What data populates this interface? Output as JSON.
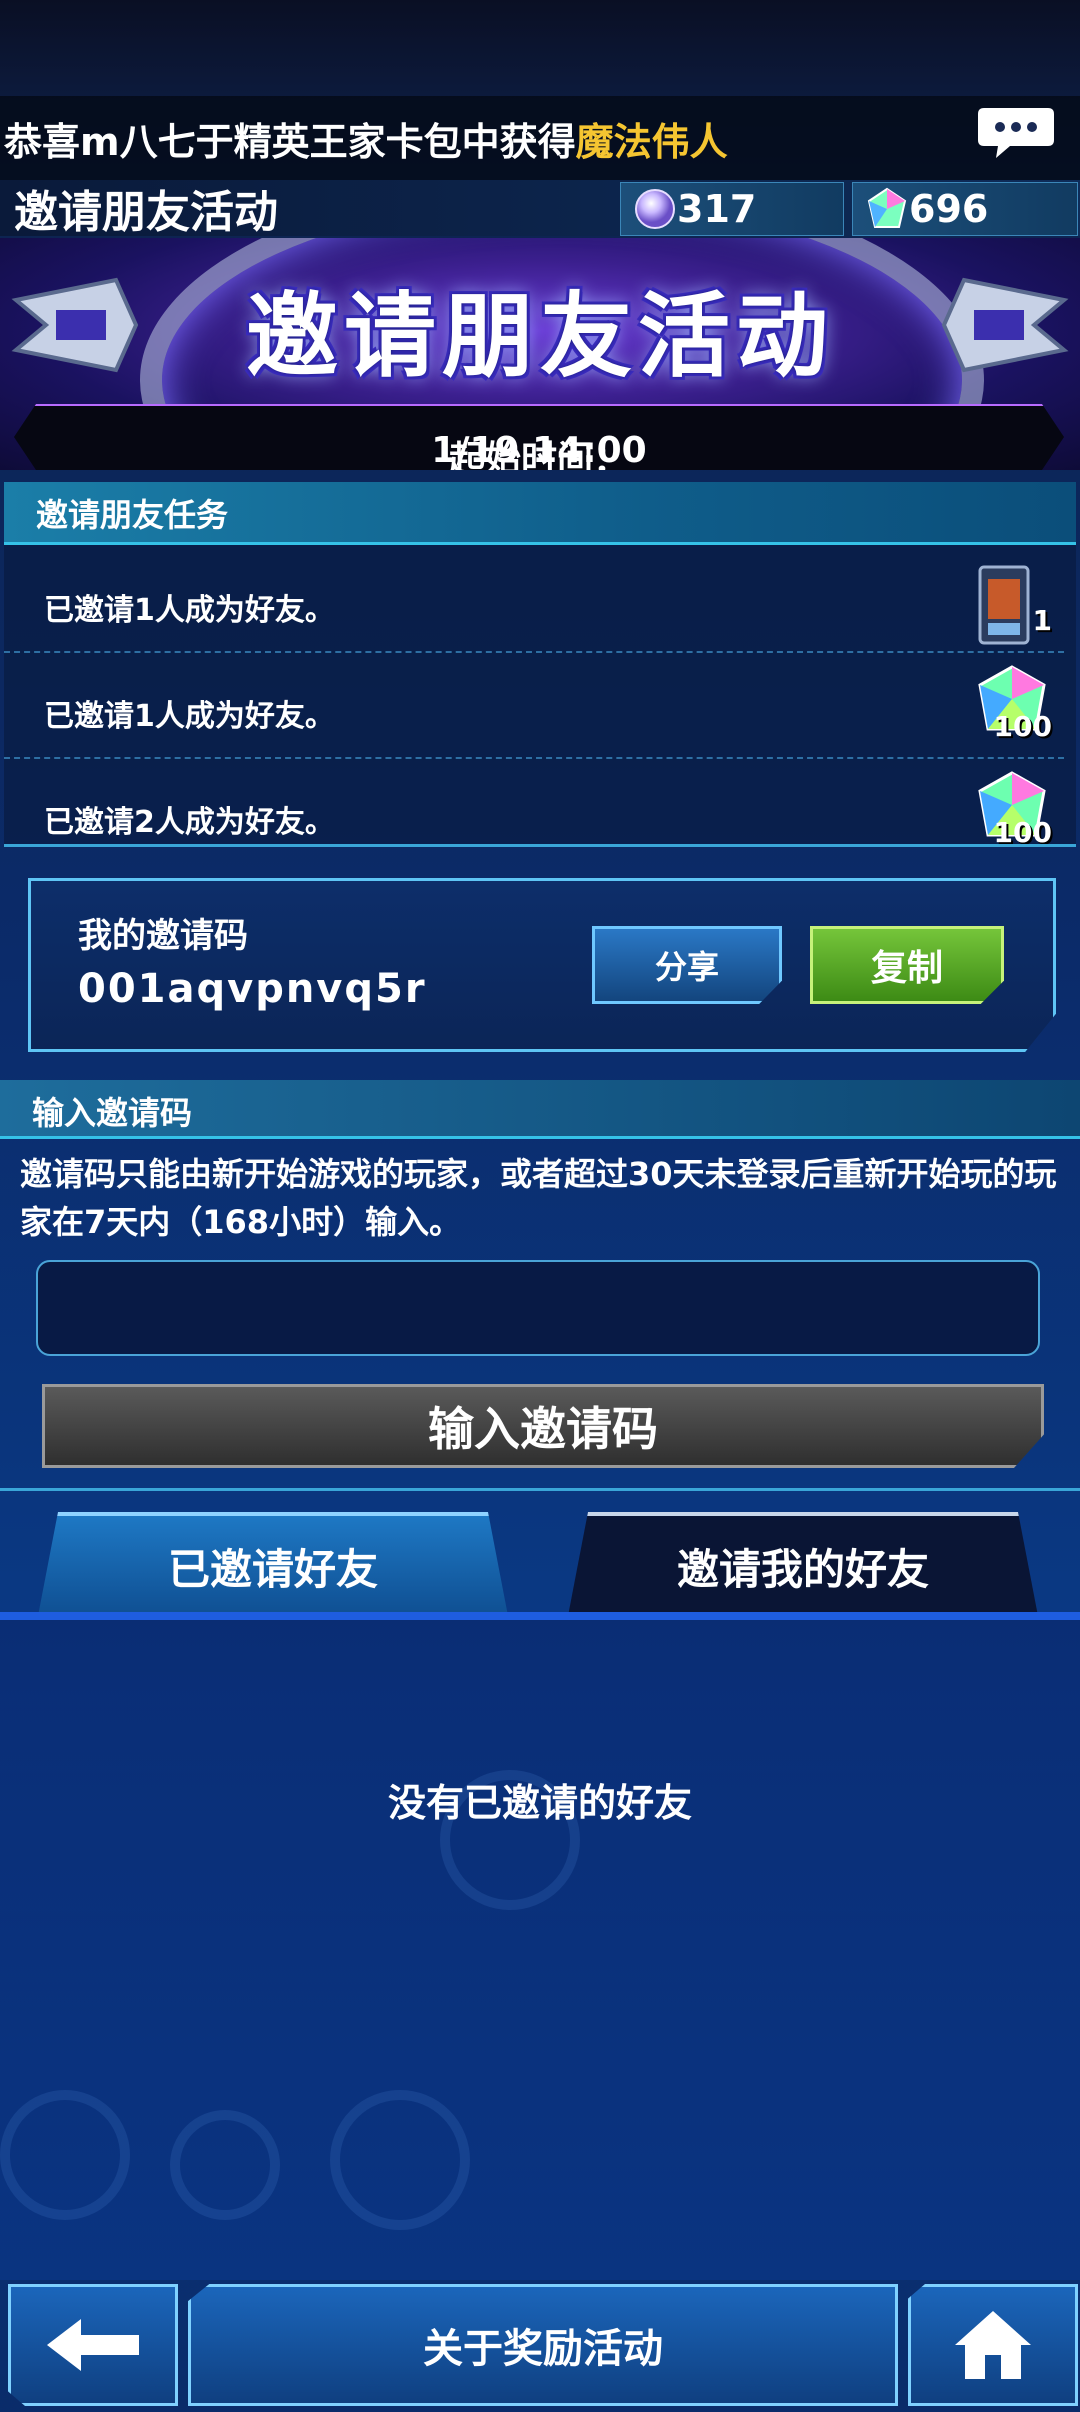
{
  "ticker": {
    "prefix": "恭喜m八七于精英王家卡包中获得",
    "highlight": "魔法伟人"
  },
  "header": {
    "title": "邀请朋友活动",
    "orb_count": "317",
    "gem_count": "696"
  },
  "banner": {
    "title": "邀请朋友活动",
    "time_label": "起始时间：",
    "time_value": "1/19 14:00"
  },
  "tasks": {
    "heading": "邀请朋友任务",
    "items": [
      {
        "label": "已邀请1人成为好友。",
        "reward": "card-pack",
        "count": "1"
      },
      {
        "label": "已邀请1人成为好友。",
        "reward": "gem",
        "count": "100"
      },
      {
        "label": "已邀请2人成为好友。",
        "reward": "gem",
        "count": "100"
      }
    ]
  },
  "my_code": {
    "label": "我的邀请码",
    "value": "001aqvpnvq5r",
    "share_label": "分享",
    "copy_label": "复制"
  },
  "input_code": {
    "heading": "输入邀请码",
    "description": "邀请码只能由新开始游戏的玩家，或者超过30天未登录后重新开始玩的玩家在7天内（168小时）输入。",
    "placeholder": "",
    "button_label": "输入邀请码"
  },
  "tabs": [
    {
      "label": "已邀请好友",
      "active": true
    },
    {
      "label": "邀请我的好友",
      "active": false
    }
  ],
  "empty_message": "没有已邀请的好友",
  "footer": {
    "about_label": "关于奖励活动",
    "back_icon": "arrow-left-icon",
    "home_icon": "home-icon"
  },
  "colors": {
    "highlight": "#f5c531",
    "copy_green": "#5aa82a",
    "accent_cyan": "#35c2e8",
    "banner_purple": "#5a33c8"
  }
}
